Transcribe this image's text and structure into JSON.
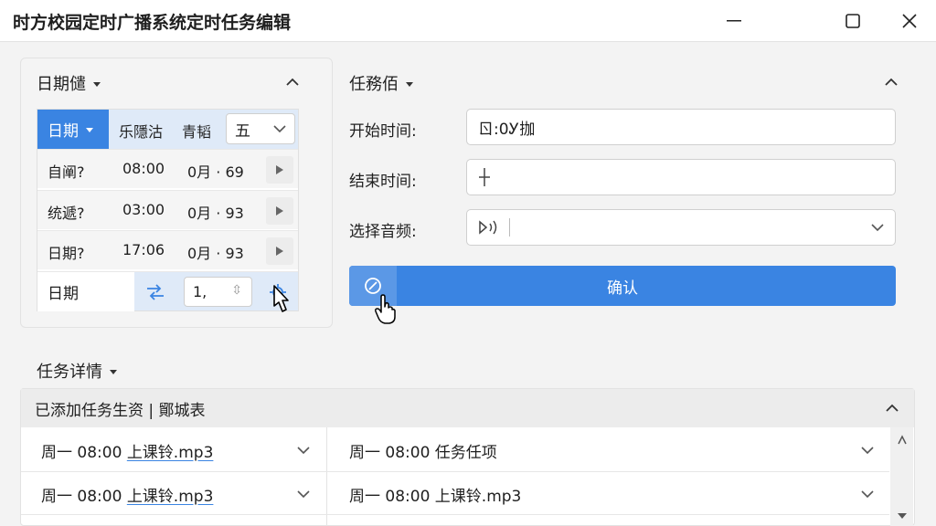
{
  "window": {
    "title": "时方校园定时广播系统定时任务编辑",
    "controls": [
      "minimize",
      "maximize",
      "close"
    ]
  },
  "date_panel": {
    "title": "日期儙",
    "header": {
      "selector_label": "日期",
      "col2": "乐隱沽",
      "col3": "青韬",
      "dropdown_value": "五"
    },
    "rows": [
      {
        "c1": "自阐?",
        "c2": "08:00",
        "c3": "0月 · 69"
      },
      {
        "c1": "统遞?",
        "c2": "03:00",
        "c3": "0月 · 93"
      },
      {
        "c1": "日期?",
        "c2": "17:06",
        "c3": "0月 · 93"
      }
    ],
    "last_row": {
      "label": "日期",
      "number_value": "1,"
    }
  },
  "task_panel": {
    "title": "任務佰",
    "start_label": "开始时间:",
    "start_value": "ㄖ:0Ꭹ拁",
    "end_label": "结束时间:",
    "end_value": "",
    "audio_label": "选择音频:",
    "audio_value": "",
    "confirm_label": "确认"
  },
  "task_detail": {
    "title": "任务详情",
    "list_header": "已添加任务生资 | 鄮城表",
    "items": [
      {
        "text_prefix": "周一 08:00 ",
        "text_link": "上课铃.mp3",
        "text_suffix": ""
      },
      {
        "text_prefix": "周一 08:00 任务任项",
        "text_link": "",
        "text_suffix": ""
      },
      {
        "text_prefix": "周一 08:00 ",
        "text_link": "上课铃.mp3",
        "text_suffix": ""
      },
      {
        "text_prefix": "周一 08:00 上课铃.mp3",
        "text_link": "",
        "text_suffix": ""
      }
    ]
  },
  "colors": {
    "accent": "#3a84e2",
    "header_tint": "#dfeaf8",
    "background": "#f3f3f3"
  }
}
